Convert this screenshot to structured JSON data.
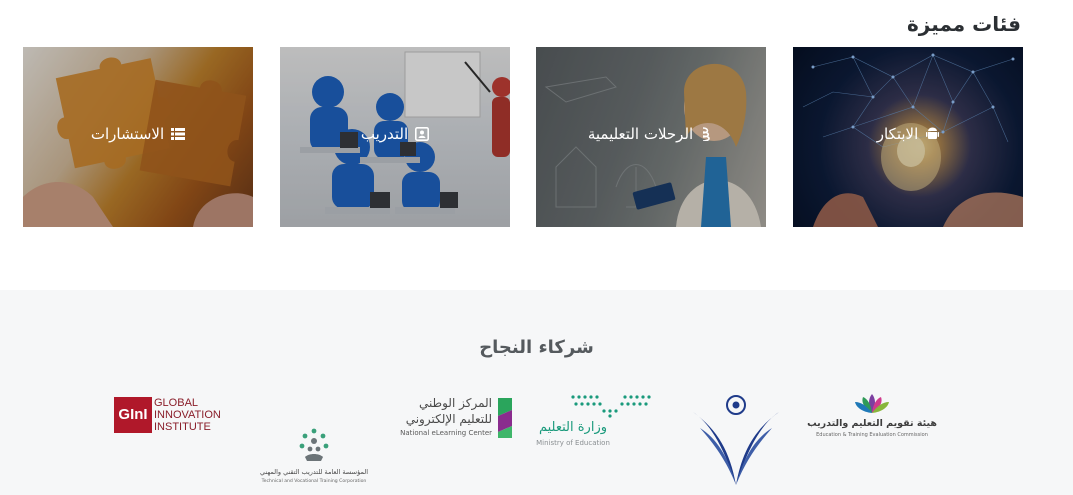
{
  "featured": {
    "title": "فئات مميزة",
    "cards": [
      {
        "label": "الابتكار",
        "icon": "android-icon"
      },
      {
        "label": "الرحلات التعليمية",
        "icon": "cloud-wave-icon"
      },
      {
        "label": "التدريب",
        "icon": "contact-card-icon"
      },
      {
        "label": "الاستشارات",
        "icon": "list-icon"
      }
    ]
  },
  "partners": {
    "title": "شركاء النجاح",
    "logos": {
      "etec_ar": "هيئة تقويم التعليم والتدريب",
      "etec_en": "Education & Training Evaluation Commission",
      "moe_ar": "وزارة التعليم",
      "moe_en": "Ministry of Education",
      "nelc_ar_1": "المركز الوطني",
      "nelc_ar_2": "للتعليم الإلكتروني",
      "nelc_en": "National eLearning Center",
      "gini_mark": "GInI",
      "gini_line1": "GLOBAL",
      "gini_line2": "INNOVATION",
      "gini_line3": "INSTITUTE",
      "tvtc_ar": "المؤسسة العامة للتدريب التقني والمهني",
      "tvtc_en": "Technical and Vocational Training Corporation"
    }
  },
  "colors": {
    "title": "#2b2f33",
    "partners_bg": "#f6f7f8",
    "moe_green": "#1a9a7c",
    "gini_red": "#b0182a",
    "navy": "#1f3b8a"
  }
}
